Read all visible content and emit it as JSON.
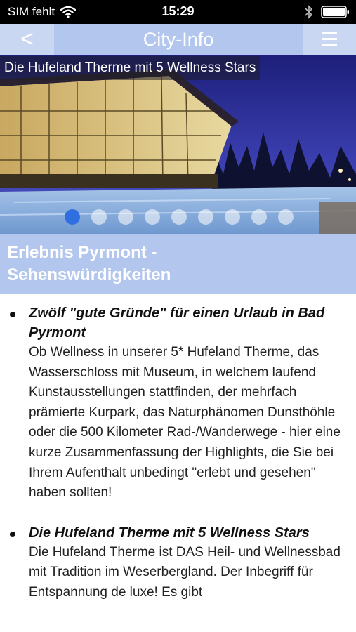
{
  "status_bar": {
    "carrier": "SIM fehlt",
    "time": "15:29"
  },
  "nav": {
    "back_label": "<",
    "title": "City-Info"
  },
  "hero": {
    "caption": "Die Hufeland Therme mit 5 Wellness Stars",
    "slide_count": 9,
    "active_slide": 1
  },
  "section": {
    "title_line1": "Erlebnis Pyrmont -",
    "title_line2": "Sehenswürdigkeiten"
  },
  "items": [
    {
      "title": "Zwölf \"gute Gründe\" für einen Urlaub in Bad Pyrmont",
      "text": "Ob Wellness in unserer 5* Hufeland Therme, das Wasserschloss mit Museum, in welchem laufend Kunstausstellungen stattfinden, der mehrfach prämierte Kurpark, das Naturphänomen Dunsthöhle oder die 500 Kilometer Rad-/Wanderwege - hier eine kurze Zusammenfassung der Highlights, die Sie bei Ihrem Aufenthalt unbedingt \"erlebt und gesehen\" haben sollten!"
    },
    {
      "title": "Die Hufeland Therme mit 5 Wellness Stars",
      "text": "Die Hufeland Therme ist DAS Heil- und Wellnessbad mit Tradition im Weserbergland. Der Inbegriff für Entspannung de luxe! Es gibt"
    }
  ],
  "colors": {
    "nav_bg": "#b3c7ee",
    "nav_button_bg": "#c9d7f3",
    "active_dot": "#2f6fe0"
  }
}
